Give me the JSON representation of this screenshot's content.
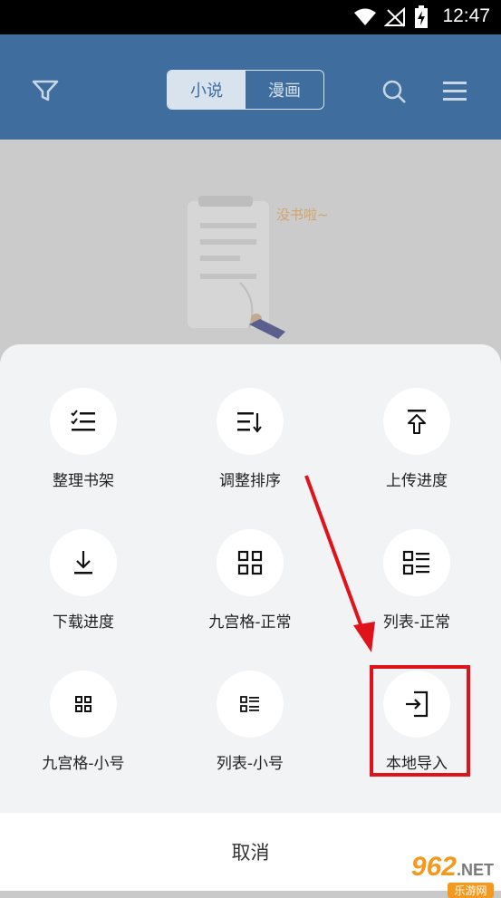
{
  "status_bar": {
    "time": "12:47"
  },
  "header": {
    "tabs": [
      {
        "label": "小说",
        "active": true
      },
      {
        "label": "漫画",
        "active": false
      }
    ]
  },
  "empty_state": {
    "text": "没书啦~"
  },
  "sheet": {
    "items": [
      {
        "label": "整理书架",
        "icon": "organize-shelf-icon"
      },
      {
        "label": "调整排序",
        "icon": "sort-icon"
      },
      {
        "label": "上传进度",
        "icon": "upload-icon"
      },
      {
        "label": "下载进度",
        "icon": "download-icon"
      },
      {
        "label": "九宫格-正常",
        "icon": "grid-icon"
      },
      {
        "label": "列表-正常",
        "icon": "list-icon"
      },
      {
        "label": "九宫格-小号",
        "icon": "grid-small-icon"
      },
      {
        "label": "列表-小号",
        "icon": "list-small-icon"
      },
      {
        "label": "本地导入",
        "icon": "local-import-icon"
      }
    ],
    "cancel_label": "取消"
  },
  "watermark": {
    "text_big": "962",
    "text_tld": ".NET",
    "text_sub": "乐游网"
  },
  "colors": {
    "header": "#3f6e9e",
    "highlight": "#e0121a"
  }
}
